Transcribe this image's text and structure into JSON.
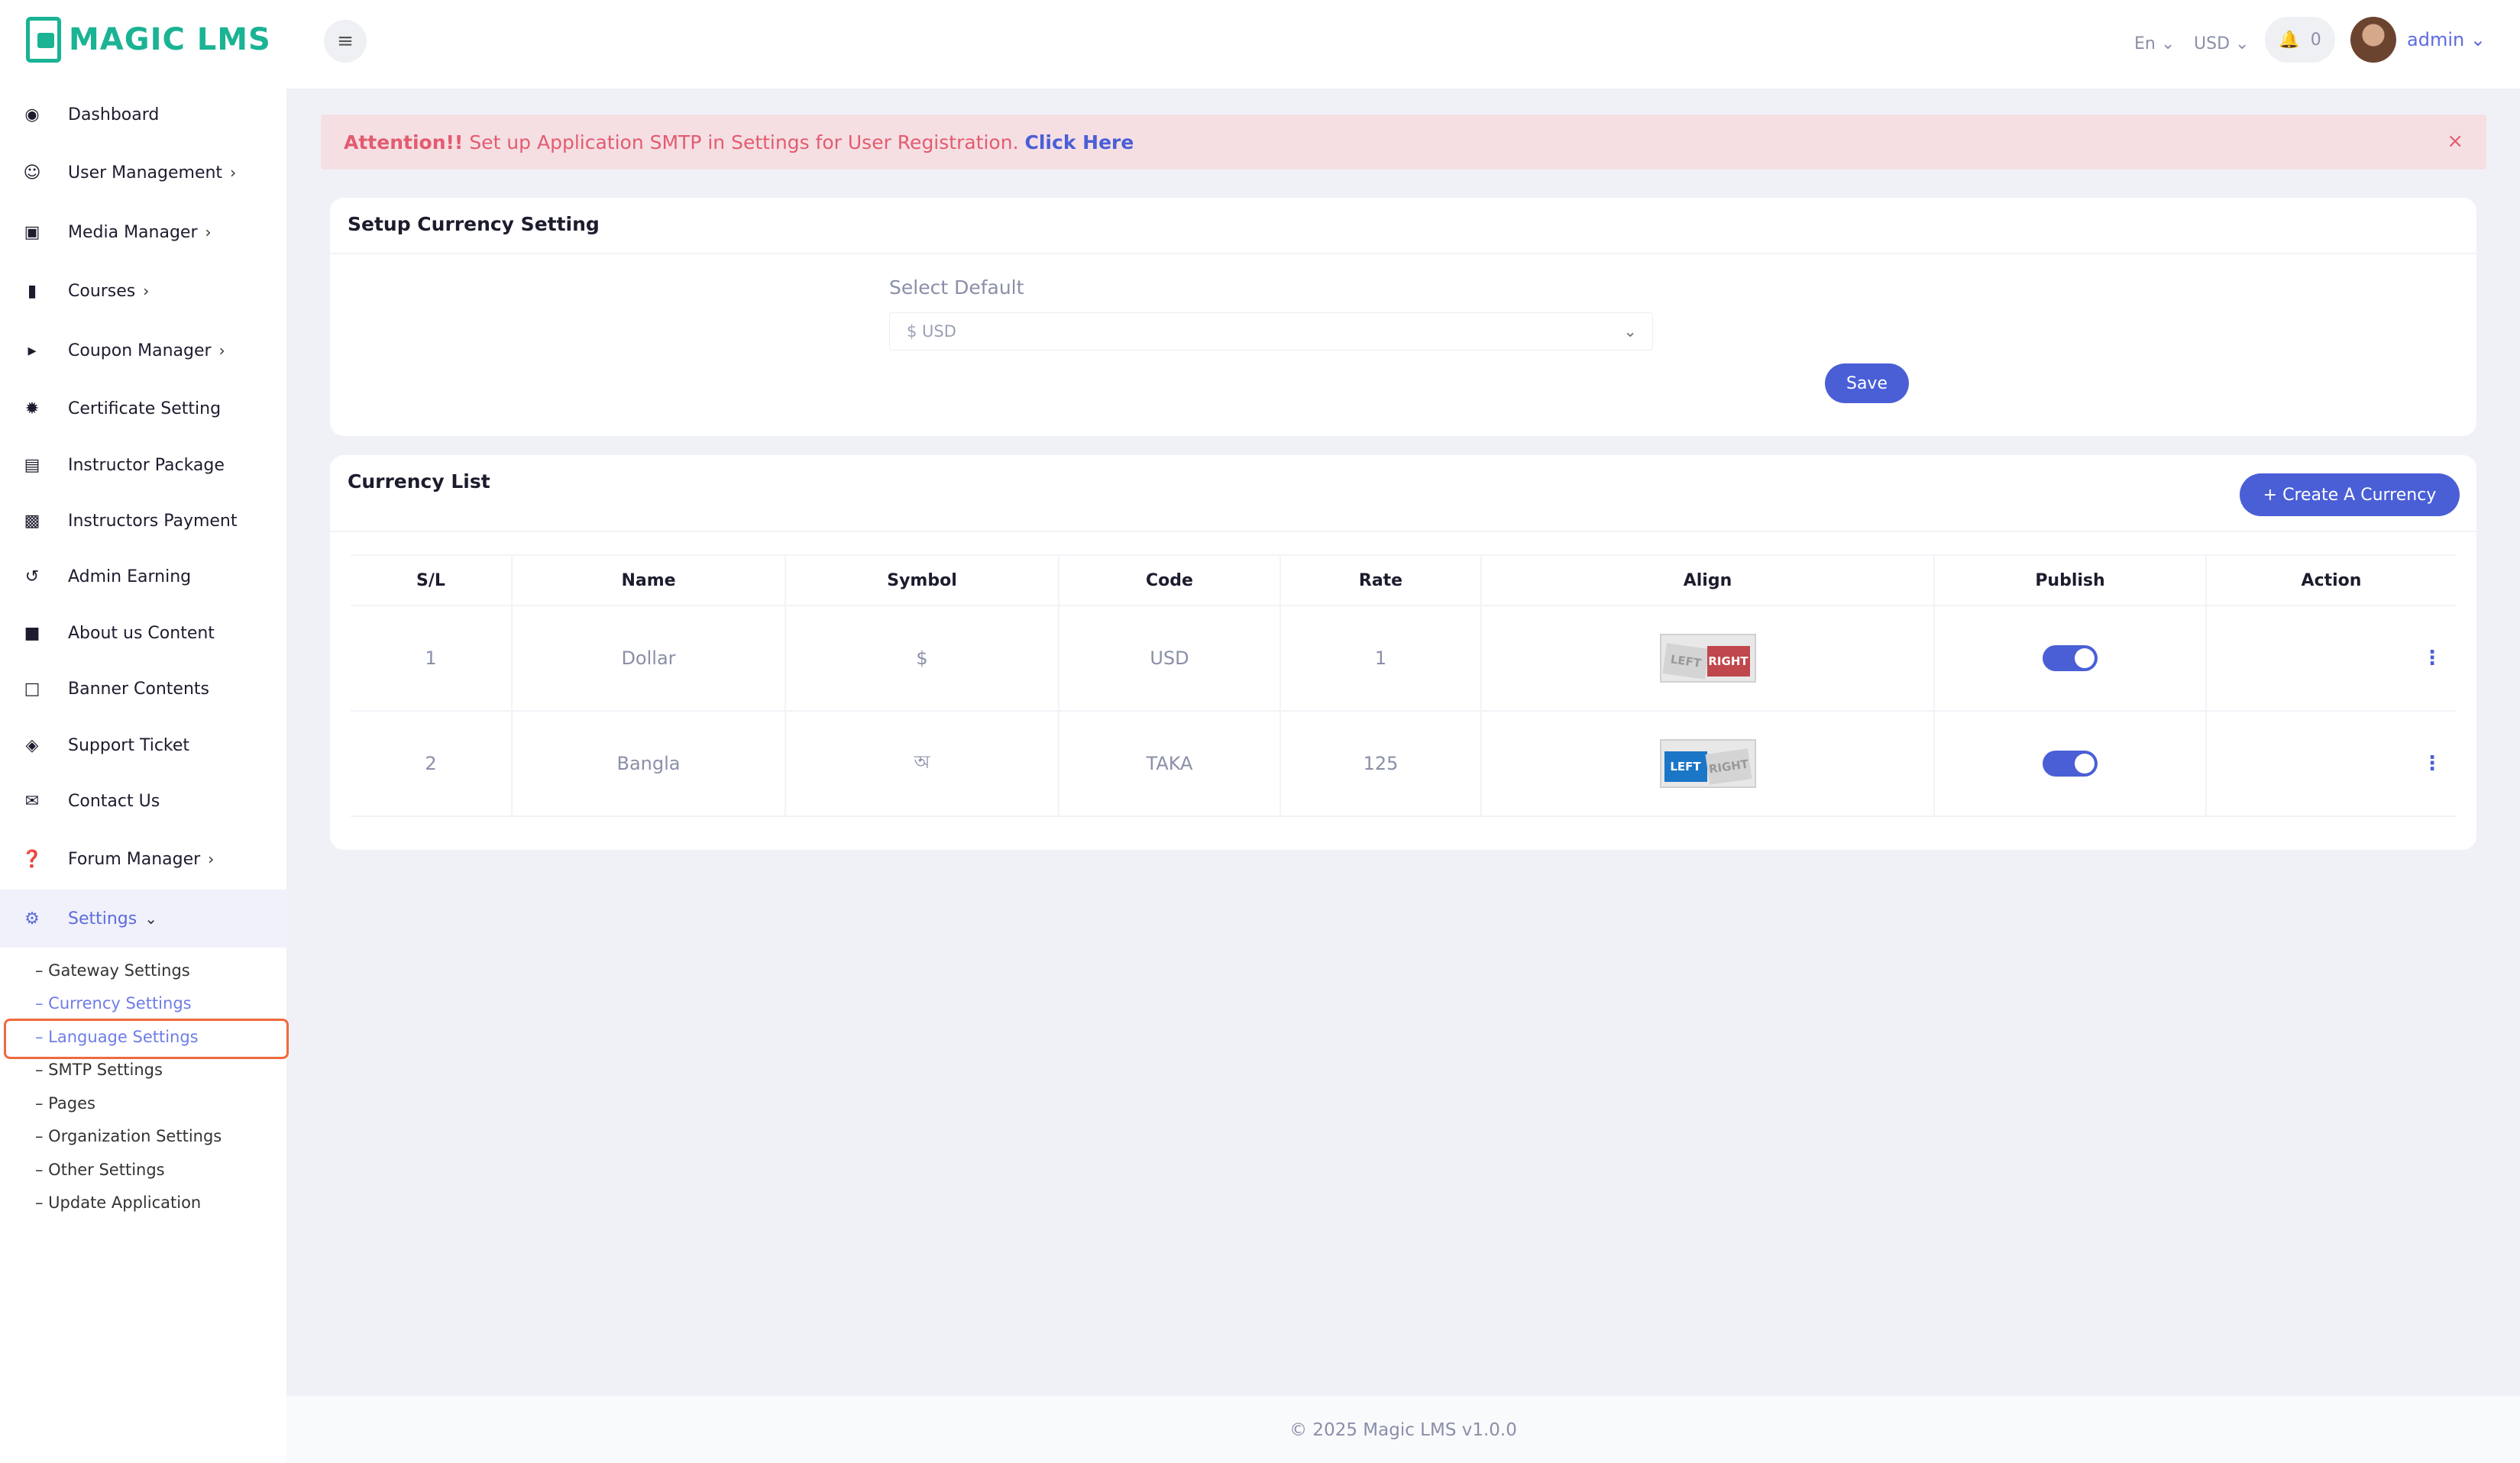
{
  "brand": {
    "name": "MAGIC LMS"
  },
  "sidebar": {
    "items": [
      {
        "label": "Dashboard",
        "icon": "dashboard-icon",
        "chevron": false
      },
      {
        "label": "User Management",
        "icon": "users-icon",
        "chevron": true
      },
      {
        "label": "Media Manager",
        "icon": "image-icon",
        "chevron": true
      },
      {
        "label": "Courses",
        "icon": "book-icon",
        "chevron": true
      },
      {
        "label": "Coupon Manager",
        "icon": "megaphone-icon",
        "chevron": true
      },
      {
        "label": "Certificate Setting",
        "icon": "certificate-icon",
        "chevron": false
      },
      {
        "label": "Instructor Package",
        "icon": "briefcase-icon",
        "chevron": false
      },
      {
        "label": "Instructors Payment",
        "icon": "money-icon",
        "chevron": false
      },
      {
        "label": "Admin Earning",
        "icon": "history-icon",
        "chevron": false
      },
      {
        "label": "About us Content",
        "icon": "sticky-note-icon",
        "chevron": false
      },
      {
        "label": "Banner Contents",
        "icon": "note-icon",
        "chevron": false
      },
      {
        "label": "Support Ticket",
        "icon": "ticket-icon",
        "chevron": false
      },
      {
        "label": "Contact Us",
        "icon": "envelope-open-icon",
        "chevron": false
      },
      {
        "label": "Forum Manager",
        "icon": "question-circle-icon",
        "chevron": true
      },
      {
        "label": "Settings",
        "icon": "gear-icon",
        "chevron": true
      }
    ],
    "settings_submenu": [
      "– Gateway Settings",
      "– Currency Settings",
      "– Language Settings",
      "– SMTP Settings",
      "– Pages",
      "– Organization Settings",
      "– Other Settings",
      "– Update Application"
    ]
  },
  "topbar": {
    "language": "En",
    "currency": "USD",
    "notification_count": "0",
    "user_name": "admin"
  },
  "alert": {
    "prefix": "Attention!!",
    "message": "Set up Application SMTP in Settings for User Registration.",
    "link_text": "Click Here",
    "close": "×"
  },
  "currency_setting": {
    "title": "Setup Currency Setting",
    "select_label": "Select Default",
    "selected_value": "$ USD",
    "save_label": "Save"
  },
  "currency_list": {
    "title": "Currency List",
    "create_label": "+ Create A Currency",
    "columns": [
      "S/L",
      "Name",
      "Symbol",
      "Code",
      "Rate",
      "Align",
      "Publish",
      "Action"
    ],
    "rows": [
      {
        "sl": "1",
        "name": "Dollar",
        "symbol": "$",
        "code": "USD",
        "rate": "1",
        "align": "rtl",
        "align_left_text": "LEFT",
        "align_right_text": "RIGHT",
        "published": true
      },
      {
        "sl": "2",
        "name": "Bangla",
        "symbol": "অ",
        "code": "TAKA",
        "rate": "125",
        "align": "ltr",
        "align_left_text": "LEFT",
        "align_right_text": "RIGHT",
        "published": true
      }
    ]
  },
  "footer": {
    "text": "© 2025 Magic LMS v1.0.0"
  },
  "colors": {
    "brand": "#1ab394",
    "primary": "#4a5fd6",
    "alert_bg": "#f5dfe3",
    "alert_text": "#e35b6f",
    "highlight": "#ef6a3d"
  }
}
